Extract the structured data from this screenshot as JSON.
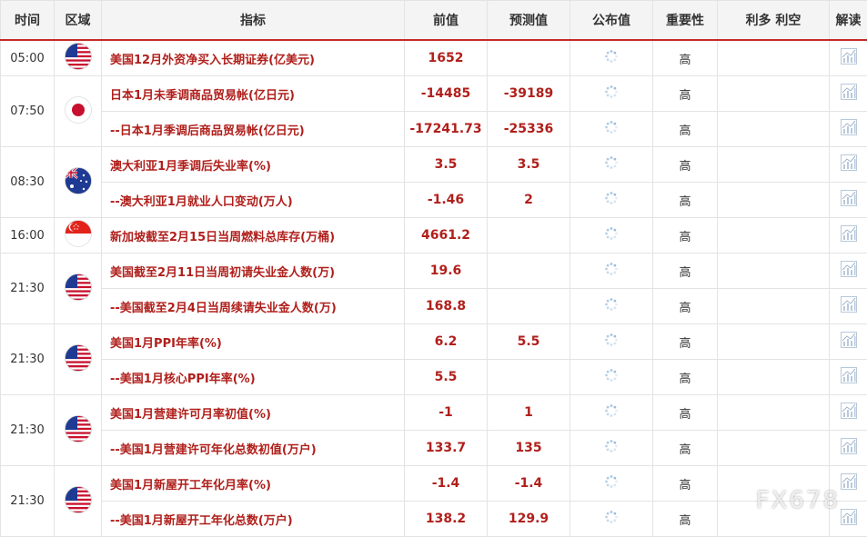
{
  "headers": {
    "time": "时间",
    "region": "区域",
    "indicator": "指标",
    "previous": "前值",
    "forecast": "预测值",
    "actual": "公布值",
    "importance": "重要性",
    "bias": "利多 利空",
    "analysis": "解读"
  },
  "groups": [
    {
      "time": "05:00",
      "flag": "us",
      "rows": [
        {
          "indicator": "美国12月外资净买入长期证券(亿美元)",
          "previous": "1652",
          "forecast": "",
          "importance": "高"
        }
      ]
    },
    {
      "time": "07:50",
      "flag": "jp",
      "rows": [
        {
          "indicator": "日本1月未季调商品贸易帐(亿日元)",
          "previous": "-14485",
          "forecast": "-39189",
          "importance": "高"
        },
        {
          "indicator": "--日本1月季调后商品贸易帐(亿日元)",
          "previous": "-17241.73",
          "forecast": "-25336",
          "importance": "高"
        }
      ]
    },
    {
      "time": "08:30",
      "flag": "au",
      "rows": [
        {
          "indicator": "澳大利亚1月季调后失业率(%)",
          "previous": "3.5",
          "forecast": "3.5",
          "importance": "高"
        },
        {
          "indicator": "--澳大利亚1月就业人口变动(万人)",
          "previous": "-1.46",
          "forecast": "2",
          "importance": "高"
        }
      ]
    },
    {
      "time": "16:00",
      "flag": "sg",
      "rows": [
        {
          "indicator": "新加坡截至2月15日当周燃料总库存(万桶)",
          "previous": "4661.2",
          "forecast": "",
          "importance": "高"
        }
      ]
    },
    {
      "time": "21:30",
      "flag": "us",
      "rows": [
        {
          "indicator": "美国截至2月11日当周初请失业金人数(万)",
          "previous": "19.6",
          "forecast": "",
          "importance": "高"
        },
        {
          "indicator": "--美国截至2月4日当周续请失业金人数(万)",
          "previous": "168.8",
          "forecast": "",
          "importance": "高"
        }
      ]
    },
    {
      "time": "21:30",
      "flag": "us",
      "rows": [
        {
          "indicator": "美国1月PPI年率(%)",
          "previous": "6.2",
          "forecast": "5.5",
          "importance": "高"
        },
        {
          "indicator": "--美国1月核心PPI年率(%)",
          "previous": "5.5",
          "forecast": "",
          "importance": "高"
        }
      ]
    },
    {
      "time": "21:30",
      "flag": "us",
      "rows": [
        {
          "indicator": "美国1月营建许可月率初值(%)",
          "previous": "-1",
          "forecast": "1",
          "importance": "高"
        },
        {
          "indicator": "--美国1月营建许可年化总数初值(万户)",
          "previous": "133.7",
          "forecast": "135",
          "importance": "高"
        }
      ]
    },
    {
      "time": "21:30",
      "flag": "us",
      "rows": [
        {
          "indicator": "美国1月新屋开工年化月率(%)",
          "previous": "-1.4",
          "forecast": "-1.4",
          "importance": "高"
        },
        {
          "indicator": "--美国1月新屋开工年化总数(万户)",
          "previous": "138.2",
          "forecast": "129.9",
          "importance": "高"
        }
      ]
    }
  ],
  "watermark": "FX678",
  "icons": {
    "actual": "loading-spinner-icon",
    "analysis": "chart-icon"
  },
  "colors": {
    "accent": "#c62b26",
    "value_text": "#b01f1b",
    "border": "#e3e3e3"
  }
}
